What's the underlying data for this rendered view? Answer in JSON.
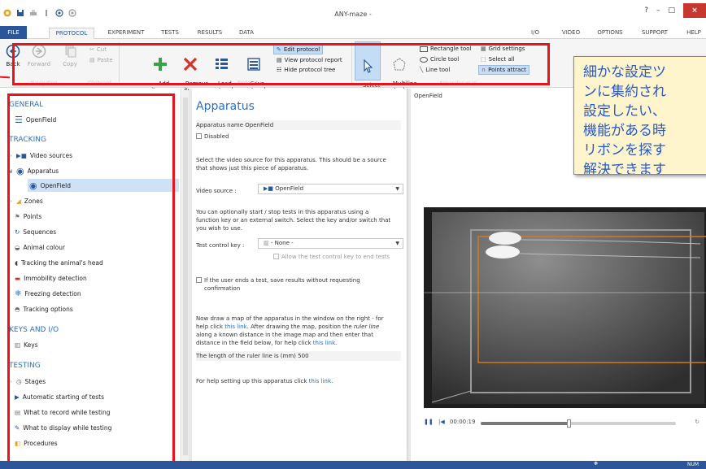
{
  "window": {
    "title": "ANY-maze -",
    "help": "?",
    "minimize": "–",
    "maximize": "□",
    "close": "×"
  },
  "menu": {
    "file": "FILE",
    "tabs_left": [
      "PROTOCOL",
      "EXPERIMENT",
      "TESTS",
      "RESULTS",
      "DATA"
    ],
    "tabs_right": [
      "I/O",
      "VIDEO",
      "OPTIONS",
      "SUPPORT",
      "HELP"
    ],
    "active_tab": "PROTOCOL"
  },
  "ribbon": {
    "back": "Back",
    "forward": "Forward",
    "copy": "Copy",
    "cut": "Cut",
    "paste": "Paste",
    "add_item": "Add\nitem ▾",
    "remove_item": "Remove\nitem",
    "load_protocol": "Load\nprotocol",
    "save_protocol": "Save\nprotocol",
    "edit_protocol": "Edit protocol",
    "view_protocol_report": "View protocol report",
    "hide_protocol_tree": "Hide protocol tree",
    "select_objects": "Select\nobjects",
    "multiline_tool": "Multiline\ntool",
    "rectangle_tool": "Rectangle tool",
    "circle_tool": "Circle tool",
    "line_tool": "Line tool",
    "grid_settings": "Grid settings",
    "select_all": "Select all",
    "points_attract": "Points attract",
    "group_labels": [
      "Navigation",
      "Clipboard",
      "Protocol",
      "Apparatus map"
    ]
  },
  "tree": {
    "general": "GENERAL",
    "openfield_top": "OpenField",
    "tracking": "TRACKING",
    "video_sources": "Video sources",
    "apparatus": "Apparatus",
    "openfield_selected": "OpenField",
    "zones": "Zones",
    "points": "Points",
    "sequences": "Sequences",
    "animal_colour": "Animal colour",
    "tracking_head": "Tracking the animal's head",
    "immobility": "Immobility detection",
    "freezing": "Freezing detection",
    "tracking_options": "Tracking options",
    "keys_io": "KEYS AND I/O",
    "keys": "Keys",
    "testing": "TESTING",
    "stages": "Stages",
    "auto_start": "Automatic starting of tests",
    "record_while": "What to record while testing",
    "display_while": "What to display while testing",
    "procedures": "Procedures"
  },
  "form": {
    "heading": "Apparatus",
    "name_label": "Apparatus name",
    "name_value": "OpenField",
    "disabled": "Disabled",
    "video_intro_1": "Select the video source for this apparatus. This should be a source",
    "video_intro_2": "that shows just this piece of apparatus.",
    "video_source_label": "Video source :",
    "video_source_value": "OpenField",
    "test_intro_1": "You can optionally start / stop tests in this apparatus using a",
    "test_intro_2": "function key or an external switch. Select the key and/or switch that",
    "test_intro_3": "you wish to use.",
    "test_key_label": "Test control key :",
    "test_key_value": "- None -",
    "allow_end": "Allow the test control key to end tests",
    "save_results_1": "If the user ends a test, save results without requesting",
    "save_results_2": "confirmation",
    "map_1": "Now draw a map of the apparatus in the window on the right - for",
    "map_2a": "help click ",
    "map_link": "this link",
    "map_2b": ". After drawing the map, position the ",
    "map_ruler": "ruler line",
    "map_3": "along a known distance in the image map and then enter that",
    "map_4a": "distance in the field below, for help click ",
    "map_link2": "this link",
    "map_4b": ".",
    "ruler_label": "The length of the ruler line is (mm)",
    "ruler_value": "500",
    "help_a": "For help setting up this apparatus click ",
    "help_link": "this link",
    "help_b": "."
  },
  "video": {
    "label": "OpenField",
    "time": "00:00:19",
    "progress": 0.45
  },
  "status": {
    "num": "NUM"
  },
  "callout": {
    "lines": [
      "細かな設定ツ",
      "ンに集約され",
      "設定したい、",
      "機能がある時",
      "リボンを探す",
      "解決できます"
    ]
  },
  "colors": {
    "accent": "#2b579a",
    "section": "#2e70b8",
    "highlight": "#e8141b",
    "callout_bg": "#fff5cc",
    "callout_text": "#2a58c7"
  }
}
